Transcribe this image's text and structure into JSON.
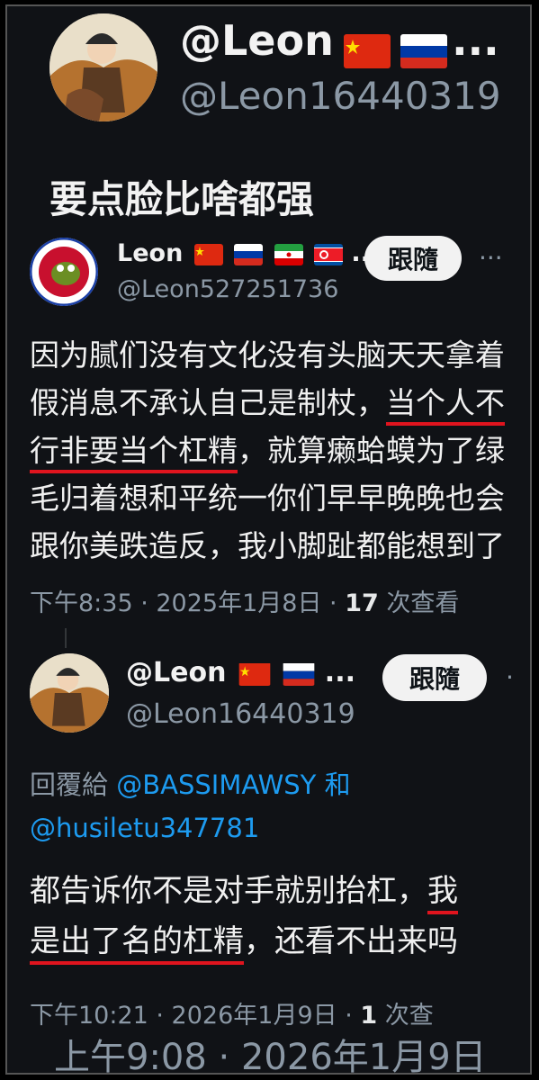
{
  "profile": {
    "display_name": "@Leon",
    "ellipsis": "...",
    "handle": "@Leon16440319"
  },
  "quote_text": "要点脸比啥都强",
  "tweet1": {
    "display_name": "Leon",
    "ellipsis": "...",
    "handle": "@Leon527251736",
    "follow_label": "跟隨",
    "more": "···",
    "body_lines": [
      "因为腻们没有文化没有头脑天天拿着",
      "假消息不承认自己是制杖，",
      "当个人不",
      "行非要当个杠精",
      "，就算癞蛤蟆为了绿",
      "毛归着想和平统一你们早早晚晚也会",
      "跟你美跌造反，我小脚趾都能想到了"
    ],
    "time": "下午8:35 · 2025年1月8日 · ",
    "views_count": "17",
    "views_label": " 次查看"
  },
  "tweet2": {
    "display_name": "@Leon",
    "ellipsis": "...",
    "handle": "@Leon16440319",
    "follow_label": "跟隨",
    "more": "·",
    "reply_prefix": "回覆給 ",
    "reply_user1": "@BASSIMAWSY",
    "reply_and": " 和",
    "reply_user2": "@husiletu347781",
    "body_lines": [
      "都告诉你不是对手就别抬杠，",
      "我",
      "是出了名的杠精",
      "，还看不出来吗"
    ],
    "time": "下午10:21 · 2026年1月9日 · ",
    "views_count": "1",
    "views_label": " 次查"
  },
  "footer_timestamp": "上午9:08 · 2026年1月9日",
  "colors": {
    "background": "#101216",
    "underline": "#e0141e",
    "link": "#1d9bf0",
    "muted": "#8b98a5"
  },
  "flags": [
    "china-flag",
    "russia-flag",
    "iran-flag",
    "north-korea-flag"
  ]
}
